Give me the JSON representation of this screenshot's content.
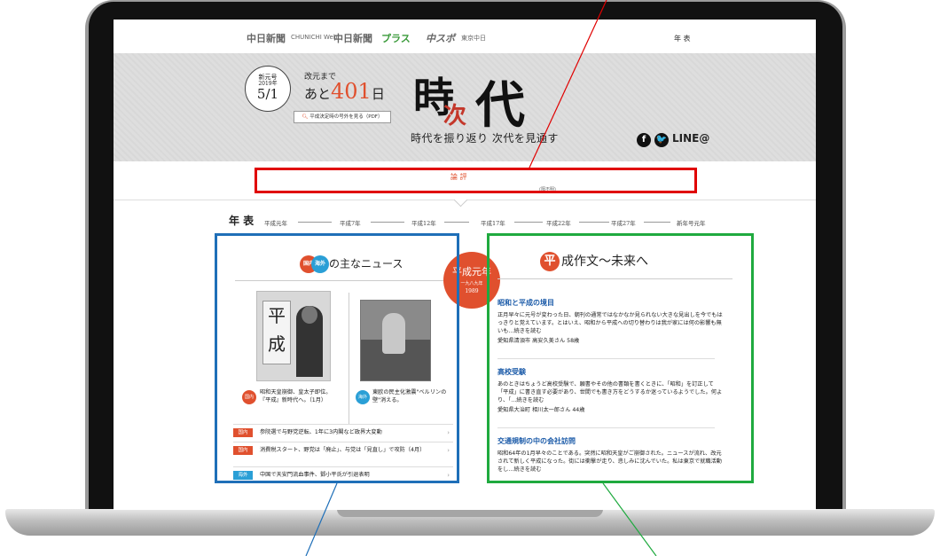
{
  "header": {
    "brands": [
      "中日新聞",
      "CHUNICHI Web",
      "中日新聞",
      "プラス",
      "中スポ",
      "東京中日"
    ],
    "nav_nenpyo": "年 表"
  },
  "hero": {
    "dial_line1": "新元号",
    "dial_line2": "2019年",
    "dial_line3": "5/1",
    "countdown_label": "改元まで",
    "countdown_prefix": "あと",
    "countdown_number": "401",
    "countdown_suffix": "日",
    "pdf_button": "平成決定時の号外を見る（PDF）",
    "logo_toki": "時",
    "logo_tsugi": "次",
    "logo_dai": "代",
    "subtitle": "時代を振り返り 次代を見通す",
    "social_fb": "f",
    "social_tw": "🐦",
    "social_line": "LINE@"
  },
  "ronpyo": {
    "title": "論 評",
    "subtitle": "(隔不明)"
  },
  "timeline": {
    "title": "年 表",
    "items": [
      "平成元年",
      "平成7年",
      "平成12年",
      "平成17年",
      "平成22年",
      "平成27年",
      "新年号元年"
    ]
  },
  "news": {
    "tag_domestic": "国内",
    "tag_intl": "海外",
    "heading": "の主なニュース",
    "photo_sign": "平成",
    "caption1": "昭和天皇崩御、皇太子即位。『平成』新時代へ。（1月）",
    "caption2": "東欧の民主化激震\"ベルリンの壁\"消える。",
    "rows": [
      {
        "tag": "国内",
        "text": "参院選で与野党逆転、1年に3内閣など政界大変動"
      },
      {
        "tag": "国内",
        "text": "消費税スタート、野党は「廃止」、与党は「見直し」で攻防（4月）"
      },
      {
        "tag": "海外",
        "text": "中国で天安門流血事件、鄧小平氏が引退表明"
      }
    ]
  },
  "badge": {
    "year": "平成元年",
    "dash": "一九八九年",
    "greg": "1989"
  },
  "essays": {
    "heading_char": "平",
    "heading": "成作文〜未来へ",
    "items": [
      {
        "title": "昭和と平成の境目",
        "body": "正月早々に元号が変わった日、朝刊の通常ではなかなか見られない大きな見出しを今でもはっきりと覚えています。とはいえ、昭和から平成への切り替わりは我が家には何の影響も無いも…続きを読む",
        "author": "愛知県清須市 高安久美さん 58歳"
      },
      {
        "title": "高校受験",
        "body": "あのときはちょうど高校受験で、願書やその他の書類を書くときに、「昭和」を訂正して「平成」に書き直す必要があり、世間でも書き方をどうするか迷っているようでした。何より、「…続きを読む",
        "author": "愛知県大治町 相川太一郎さん 44歳"
      },
      {
        "title": "交通規制の中の会社訪問",
        "body": "昭和64年の1月早々のことである。突然に昭和天皇がご崩御された。ニュースが流れ、改元されて新しく平成になった。街には衝撃が走り、悲しみに沈んでいた。私は東京で就職活動をし…続きを読む",
        "author": ""
      }
    ]
  },
  "colors": {
    "accent": "#e0502e",
    "annot_red": "#e00000",
    "annot_blue": "#1f6fb8",
    "annot_green": "#1faa3f"
  }
}
